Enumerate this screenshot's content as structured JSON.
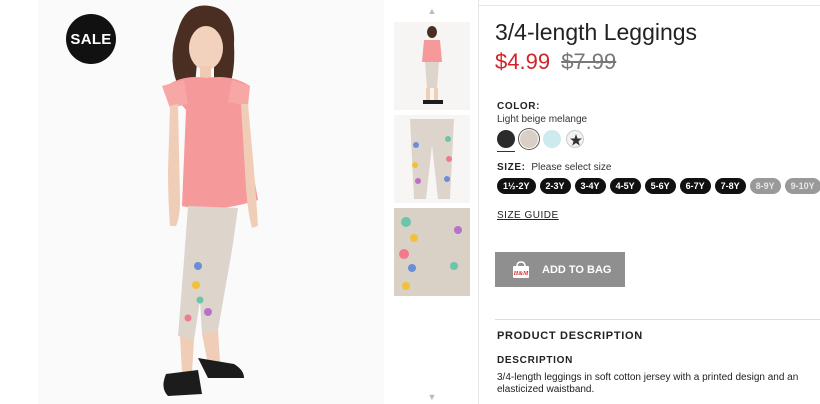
{
  "badge": {
    "sale": "SALE"
  },
  "product": {
    "title": "3/4-length Leggings",
    "price_new": "$4.99",
    "price_old": "$7.99"
  },
  "color": {
    "label": "COLOR:",
    "selected_name": "Light beige melange",
    "swatches": [
      {
        "name": "dark-grey",
        "hex": "#2b2b2b"
      },
      {
        "name": "light-beige-melange",
        "hex": "#d9cfc5",
        "selected": true
      },
      {
        "name": "light-turquoise",
        "hex": "#cdebee"
      },
      {
        "name": "white-patterned",
        "hex": "#f2f2f2"
      }
    ]
  },
  "size": {
    "label": "SIZE:",
    "hint": "Please select size",
    "options": [
      {
        "label": "1½-2Y",
        "available": true
      },
      {
        "label": "2-3Y",
        "available": true
      },
      {
        "label": "3-4Y",
        "available": true
      },
      {
        "label": "4-5Y",
        "available": true
      },
      {
        "label": "5-6Y",
        "available": true
      },
      {
        "label": "6-7Y",
        "available": true
      },
      {
        "label": "7-8Y",
        "available": true
      },
      {
        "label": "8-9Y",
        "available": false
      },
      {
        "label": "9-10Y",
        "available": false
      }
    ],
    "guide_link": "SIZE GUIDE"
  },
  "cart": {
    "add_label": "ADD TO BAG",
    "bag_logo": "H&M"
  },
  "description": {
    "section_title": "PRODUCT DESCRIPTION",
    "heading": "DESCRIPTION",
    "text": "3/4-length leggings in soft cotton jersey with a printed design and an elasticized waistband."
  },
  "colors": {
    "sale_red": "#d2232a",
    "button_grey": "#8f8f8f",
    "pill_black": "#111111"
  }
}
